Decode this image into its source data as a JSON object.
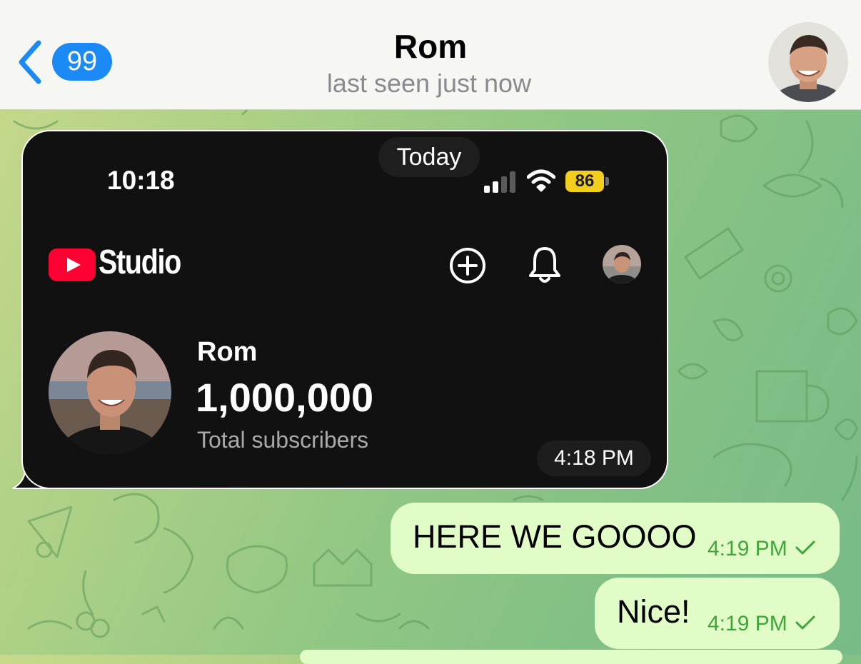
{
  "header": {
    "back_label": "Back",
    "unread_count": "99",
    "title": "Rom",
    "status": "last seen just now"
  },
  "photo_message": {
    "date_label": "Today",
    "status_bar": {
      "time": "10:18",
      "battery": "86"
    },
    "app_name": "Studio",
    "channel": {
      "name": "Rom",
      "subscribers": "1,000,000",
      "subscribers_label": "Total subscribers"
    },
    "sent_time": "4:18 PM"
  },
  "messages": [
    {
      "text": "HERE WE GOOOO",
      "time": "4:19 PM",
      "read_state": "sent"
    },
    {
      "text": "Nice!",
      "time": "4:19 PM",
      "read_state": "sent"
    }
  ],
  "colors": {
    "accent": "#1c8af5",
    "outgoing_bubble": "#e1fcc7",
    "outgoing_meta": "#3fa63a",
    "youtube_red": "#ff0033",
    "battery_yellow": "#f2cf1f"
  },
  "icons": {
    "back": "chevron-left-icon",
    "signal": "cellular-signal-icon",
    "wifi": "wifi-icon",
    "youtube": "youtube-logo-icon",
    "create": "add-circle-icon",
    "notifications": "bell-icon",
    "read_receipt": "check-icon"
  }
}
